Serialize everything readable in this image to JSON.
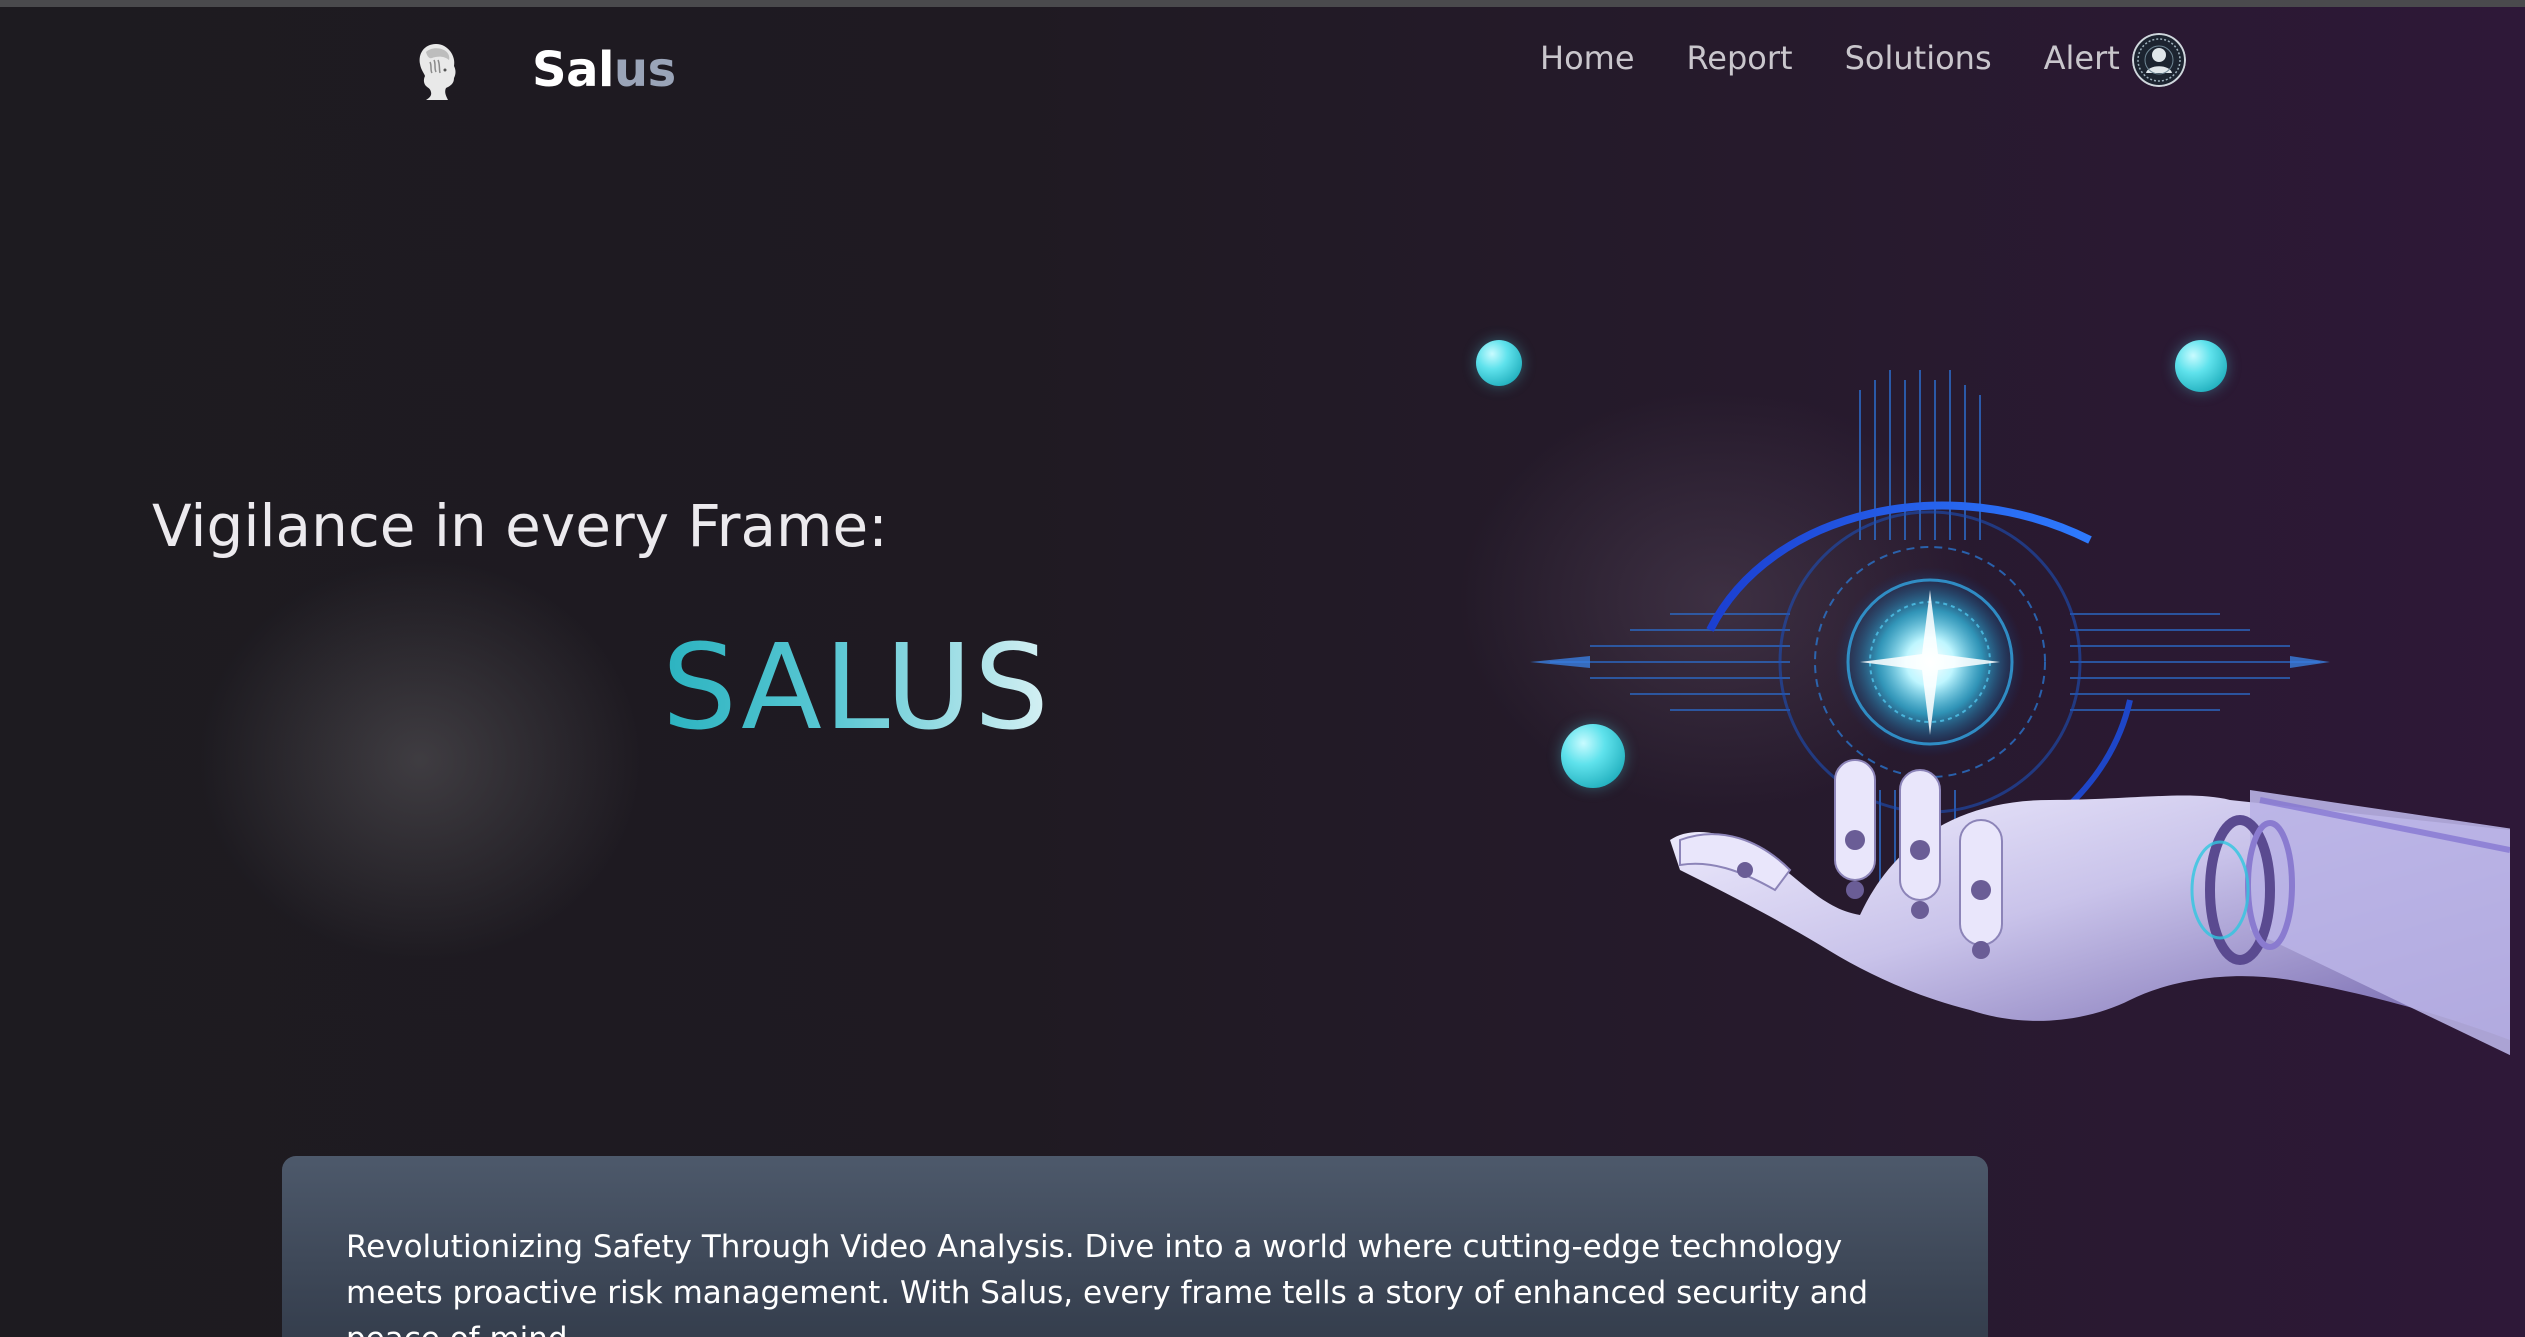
{
  "app": {
    "brand_prefix": "Sal",
    "brand_suffix": "us"
  },
  "nav": {
    "items": [
      "Home",
      "Report",
      "Solutions",
      "Alert"
    ]
  },
  "hero": {
    "tagline": "Vigilance in every Frame:",
    "title": "SALUS"
  },
  "info": {
    "text": "Revolutionizing Safety Through Video Analysis. Dive into a world where cutting-edge technology meets proactive risk management. With Salus, every frame tells a story of enhanced security and peace of mind."
  },
  "icons": {
    "logo": "woman-profile-logo-icon",
    "avatar": "user-avatar-icon",
    "illustration": "robot-hand-holding-glowing-circuit-icon"
  },
  "colors": {
    "background_start": "#1d1b20",
    "background_end": "#2e1838",
    "accent_cyan": "#2bb3c0",
    "orb": "#5fe2ec",
    "card": "#4d596b"
  }
}
